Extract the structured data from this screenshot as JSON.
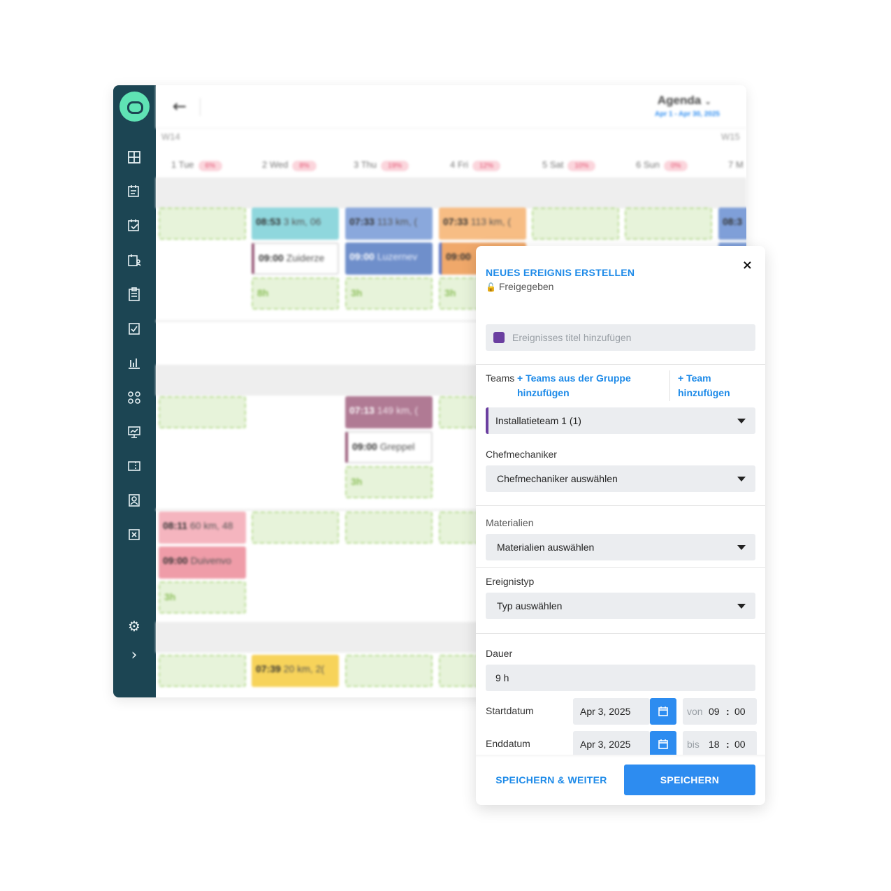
{
  "header": {
    "view_label": "Agenda",
    "view_chevron": "⌄",
    "date_range": "Apr 1 - Apr 30, 2025",
    "back_glyph": "←"
  },
  "weeks": {
    "w14": "W14",
    "w15": "W15"
  },
  "days": [
    {
      "label": "1 Tue",
      "pct": "6%"
    },
    {
      "label": "2 Wed",
      "pct": "8%"
    },
    {
      "label": "3 Thu",
      "pct": "19%"
    },
    {
      "label": "4 Fri",
      "pct": "12%"
    },
    {
      "label": "5 Sat",
      "pct": "10%"
    },
    {
      "label": "6 Sun",
      "pct": "0%"
    },
    {
      "label": "7 M"
    }
  ],
  "events": [
    {
      "time": "08:53",
      "text": "3 km, 06"
    },
    {
      "time": "09:00",
      "text": "Zuiderze"
    },
    {
      "hours": "8h"
    },
    {
      "time": "07:33",
      "text": "113 km, ("
    },
    {
      "time": "09:00",
      "text": "Luzernev"
    },
    {
      "hours": "3h"
    },
    {
      "time": "07:33",
      "text": "113 km, ("
    },
    {
      "time": "09:00",
      "text": ""
    },
    {
      "hours": "3h"
    },
    {
      "time": "08:3",
      "text": ""
    },
    {
      "time": "07:13",
      "text": "149 km, ("
    },
    {
      "time": "09:00",
      "text": "Greppel"
    },
    {
      "hours": "3h"
    },
    {
      "time": "08:11",
      "text": "60 km, 48"
    },
    {
      "time": "09:00",
      "text": "Duivenvo"
    },
    {
      "hours": "3h"
    },
    {
      "time": "07:39",
      "text": "20 km, 2("
    }
  ],
  "sidebar": {
    "icons": [
      "dashboard-icon",
      "calendar-list-icon",
      "calendar-check-icon",
      "calendar-user-icon",
      "clipboard-icon",
      "task-check-icon",
      "bar-chart-icon",
      "workflow-icon",
      "presentation-icon",
      "ticket-icon",
      "contact-card-icon",
      "close-box-icon"
    ],
    "settings_glyph": "⚙",
    "expand_glyph": "›"
  },
  "modal": {
    "title": "NEUES EREIGNIS ERSTELLEN",
    "lock_glyph": "🔓",
    "status": "Freigegeben",
    "close_glyph": "×",
    "title_placeholder": "Ereignisses titel hinzufügen",
    "color_accent": "#6b3fa0",
    "teams_label": "Teams",
    "add_group_teams": "+ Teams aus der Gruppe hinzufügen",
    "add_team": "+ Team hinzufügen",
    "team_selected": "Installatieteam 1 (1)",
    "chef_label": "Chefmechaniker",
    "chef_placeholder": "Chefmechaniker auswählen",
    "materials_label": "Materialien",
    "materials_placeholder": "Materialien auswählen",
    "type_label": "Ereignistyp",
    "type_placeholder": "Typ auswählen",
    "duration_label": "Dauer",
    "duration_value": "9 h",
    "start_label": "Startdatum",
    "start_date": "Apr 3, 2025",
    "start_prefix": "von",
    "start_hour": "09",
    "start_min": "00",
    "end_label": "Enddatum",
    "end_date": "Apr 3, 2025",
    "end_prefix": "bis",
    "end_hour": "18",
    "end_min": "00",
    "time_colon": ":",
    "save_continue": "SPEICHERN & WEITER",
    "save": "SPEICHERN"
  },
  "colors": {
    "sidebar": "#1c4553",
    "accent": "#2d8cf0",
    "logo": "#5fe3b4",
    "link": "#1d8ae8"
  }
}
